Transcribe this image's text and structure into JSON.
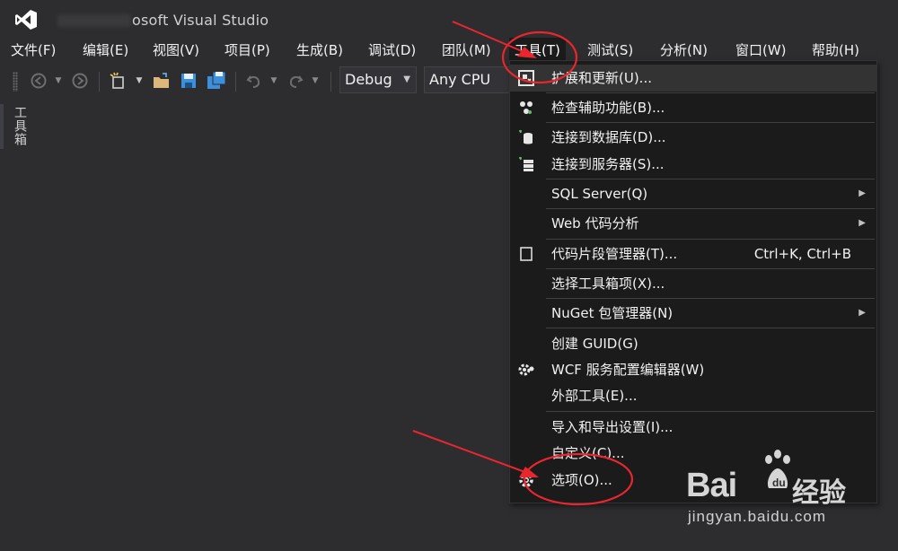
{
  "window": {
    "title": "Microsoft Visual Studio",
    "title_visible": "osoft Visual Studio"
  },
  "menubar": [
    {
      "id": "file",
      "label": "文件(F)"
    },
    {
      "id": "edit",
      "label": "编辑(E)"
    },
    {
      "id": "view",
      "label": "视图(V)"
    },
    {
      "id": "project",
      "label": "项目(P)"
    },
    {
      "id": "build",
      "label": "生成(B)"
    },
    {
      "id": "debug",
      "label": "调试(D)"
    },
    {
      "id": "team",
      "label": "团队(M)"
    },
    {
      "id": "tools",
      "label": "工具(T)"
    },
    {
      "id": "test",
      "label": "测试(S)"
    },
    {
      "id": "analyze",
      "label": "分析(N)"
    },
    {
      "id": "window",
      "label": "窗口(W)"
    },
    {
      "id": "help",
      "label": "帮助(H)"
    }
  ],
  "toolbar": {
    "config": "Debug",
    "platform": "Any CPU"
  },
  "side": {
    "toolbox": "工具箱"
  },
  "tools_menu": {
    "items": [
      {
        "label": "扩展和更新(U)...",
        "icon": "extensions-icon"
      },
      {
        "label": "检查辅助功能(B)...",
        "icon": "accessibility-icon"
      },
      {
        "label": "连接到数据库(D)...",
        "icon": "database-icon"
      },
      {
        "label": "连接到服务器(S)...",
        "icon": "server-icon"
      },
      {
        "label": "SQL Server(Q)",
        "submenu": true
      },
      {
        "label": "Web 代码分析",
        "submenu": true
      },
      {
        "label": "代码片段管理器(T)...",
        "shortcut": "Ctrl+K, Ctrl+B",
        "icon": "snippet-icon"
      },
      {
        "label": "选择工具箱项(X)..."
      },
      {
        "label": "NuGet 包管理器(N)",
        "submenu": true
      },
      {
        "label": "创建 GUID(G)"
      },
      {
        "label": "WCF 服务配置编辑器(W)",
        "icon": "wcf-gear-icon"
      },
      {
        "label": "外部工具(E)..."
      },
      {
        "label": "导入和导出设置(I)..."
      },
      {
        "label": "自定义(C)..."
      },
      {
        "label": "选项(O)...",
        "icon": "gear-icon"
      }
    ]
  },
  "watermark": {
    "brand": "Bai",
    "brand_cn": "经验",
    "url": "jingyan.baidu.com"
  },
  "colors": {
    "annotation": "#e8262e",
    "menu_bg": "#1b1b1c",
    "ide_bg": "#2d2d30"
  }
}
